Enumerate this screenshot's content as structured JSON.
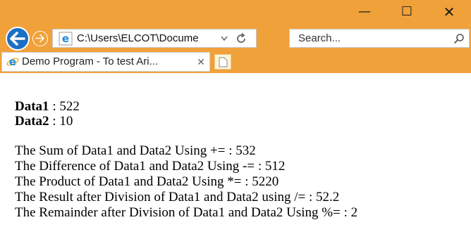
{
  "browser": {
    "address": "C:\\Users\\ELCOT\\Docume",
    "search_placeholder": "Search...",
    "tab_title": "Demo Program - To test Ari...",
    "colors": {
      "chrome": "#f0a13a",
      "back_button": "#1b6fc5"
    }
  },
  "page": {
    "data1_label": "Data1",
    "data1_value": " : 522",
    "data2_label": "Data2",
    "data2_value": " : 10",
    "results": [
      "The Sum of Data1 and Data2 Using += : 532",
      "The Difference of Data1 and Data2 Using -= : 512",
      "The Product of Data1 and Data2 Using *= : 5220",
      "The Result after Division of Data1 and Data2 using /= : 52.2",
      "The Remainder after Division of Data1 and Data2 Using %= : 2"
    ]
  }
}
